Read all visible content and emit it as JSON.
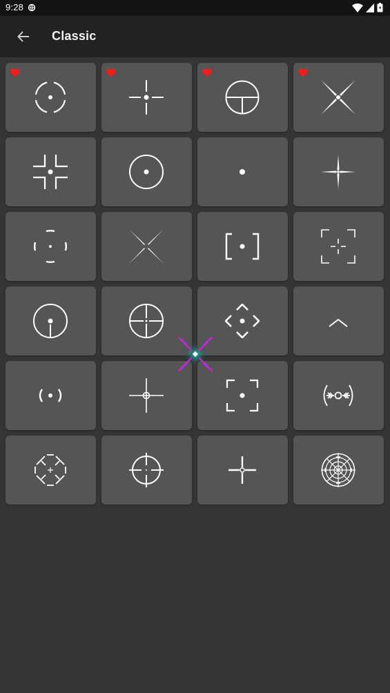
{
  "status_bar": {
    "time": "9:28",
    "icons": [
      "vpn-globe-icon",
      "wifi-icon",
      "signal-icon",
      "battery-icon"
    ]
  },
  "app_bar": {
    "title": "Classic",
    "back_icon": "arrow-left-icon"
  },
  "colors": {
    "background": "#353535",
    "tile": "#555555",
    "app_bar": "#222222",
    "status_bar": "#141414",
    "favorite": "#ff1a1a",
    "crosshair": "#ffffff",
    "overlay_accent": "#d61fd6"
  },
  "crosshairs": [
    {
      "icon": "split-circle-dot-crosshair-icon",
      "favorite": true
    },
    {
      "icon": "gap-cross-dot-crosshair-icon",
      "favorite": true
    },
    {
      "icon": "circle-t-crosshair-icon",
      "favorite": true
    },
    {
      "icon": "x-dot-crosshair-icon",
      "favorite": true
    },
    {
      "icon": "corner-brackets-dot-crosshair-icon",
      "favorite": false
    },
    {
      "icon": "circle-dot-crosshair-icon",
      "favorite": false
    },
    {
      "icon": "dot-crosshair-icon",
      "favorite": false
    },
    {
      "icon": "star-cross-crosshair-icon",
      "favorite": false
    },
    {
      "icon": "dashed-circle-dot-crosshair-icon",
      "favorite": false
    },
    {
      "icon": "x-crosshair-icon",
      "favorite": false
    },
    {
      "icon": "square-brackets-dot-crosshair-icon",
      "favorite": false
    },
    {
      "icon": "frame-corners-cross-crosshair-icon",
      "favorite": false
    },
    {
      "icon": "circle-dot-stem-crosshair-icon",
      "favorite": false
    },
    {
      "icon": "circle-cross-gap-crosshair-icon",
      "favorite": false
    },
    {
      "icon": "diamond-chevrons-dot-crosshair-icon",
      "favorite": false
    },
    {
      "icon": "chevron-up-crosshair-icon",
      "favorite": false
    },
    {
      "icon": "parentheses-dot-crosshair-icon",
      "favorite": false
    },
    {
      "icon": "cross-small-circle-crosshair-icon",
      "favorite": false
    },
    {
      "icon": "frame-corners-dot-crosshair-icon",
      "favorite": false
    },
    {
      "icon": "arrows-ring-crosshair-icon",
      "favorite": false
    },
    {
      "icon": "octagon-plus-crosshair-icon",
      "favorite": false
    },
    {
      "icon": "scope-circle-crosshair-icon",
      "favorite": false
    },
    {
      "icon": "plus-ring-crosshair-icon",
      "favorite": false
    },
    {
      "icon": "target-reticle-crosshair-icon",
      "favorite": false
    }
  ],
  "overlay": {
    "icon": "floating-crosshair-overlay-icon"
  }
}
